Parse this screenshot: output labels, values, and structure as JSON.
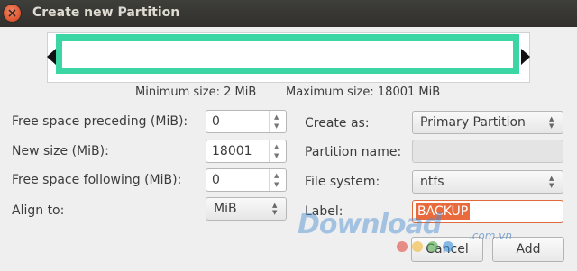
{
  "window": {
    "title": "Create new Partition"
  },
  "partition_view": {
    "bar_color": "#3bd6a4",
    "size_fraction": 1.0
  },
  "sizes": {
    "minimum": "Minimum size: 2 MiB",
    "maximum": "Maximum size: 18001 MiB"
  },
  "left_form": {
    "free_preceding": {
      "label": "Free space preceding (MiB):",
      "value": "0"
    },
    "new_size": {
      "label": "New size (MiB):",
      "value": "18001"
    },
    "free_following": {
      "label": "Free space following (MiB):",
      "value": "0"
    },
    "align_to": {
      "label": "Align to:",
      "value": "MiB"
    }
  },
  "right_form": {
    "create_as": {
      "label": "Create as:",
      "value": "Primary Partition"
    },
    "partition_name": {
      "label": "Partition name:",
      "value": ""
    },
    "file_system": {
      "label": "File system:",
      "value": "ntfs"
    },
    "label_field": {
      "label": "Label:",
      "value": "BACKUP"
    }
  },
  "buttons": {
    "cancel": "Cancel",
    "add": "Add"
  },
  "watermark": {
    "text": "Download",
    "suffix": ".com.vn",
    "dot_colors": [
      "#e0483e",
      "#f2b632",
      "#4ca64c",
      "#3a8fd8"
    ]
  },
  "colors": {
    "accent": "#e96b3d",
    "titlebar": "#33322f"
  }
}
